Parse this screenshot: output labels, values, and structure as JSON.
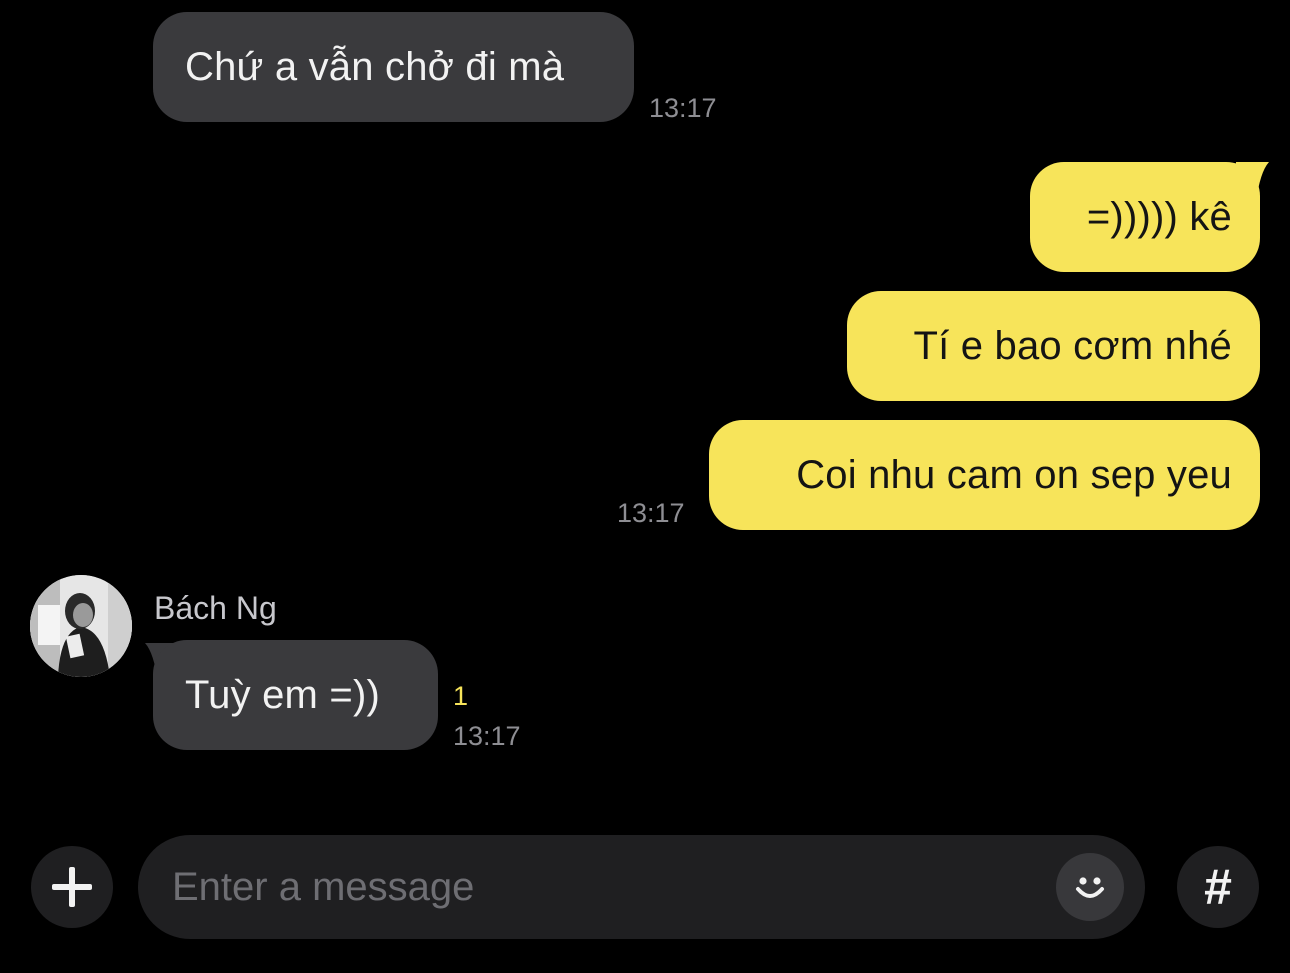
{
  "messages": [
    {
      "direction": "in",
      "text": "Chứ a vẫn chở đi mà",
      "time": "13:17"
    },
    {
      "direction": "out",
      "text": "=))))) kê"
    },
    {
      "direction": "out",
      "text": "Tí e bao cơm nhé"
    },
    {
      "direction": "out",
      "text": "Coi nhu cam on sep yeu",
      "time": "13:17"
    },
    {
      "direction": "in",
      "sender": "Bách Ng",
      "text": "Tuỳ em =))",
      "unread": "1",
      "time": "13:17"
    }
  ],
  "composer": {
    "placeholder": "Enter a message",
    "attach_icon": "plus-icon",
    "emoji_icon": "smiley-icon",
    "hashtag_icon": "hash-icon",
    "hashtag_label": "#"
  },
  "colors": {
    "background": "#000000",
    "incoming_bubble": "#3a3a3d",
    "outgoing_bubble": "#f7e45a",
    "timestamp": "#8e8e93",
    "unread_count": "#f7e45a",
    "input_background": "#1f1f21"
  }
}
